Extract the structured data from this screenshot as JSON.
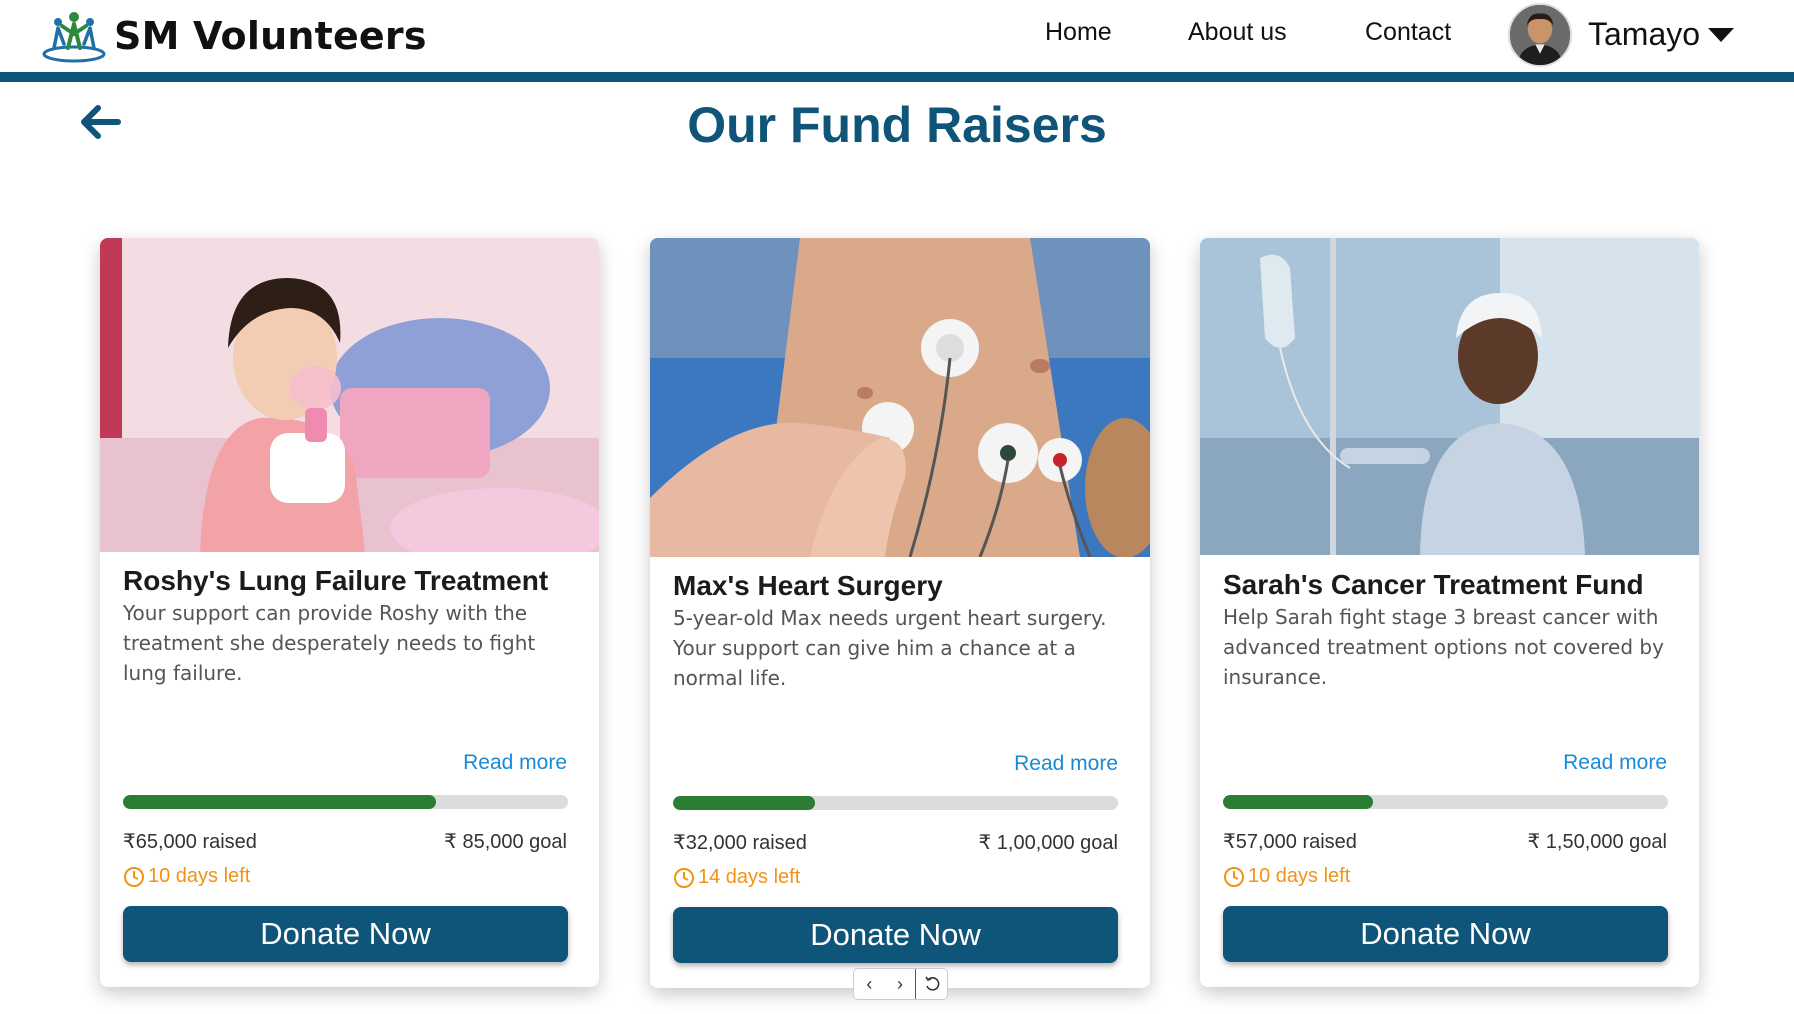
{
  "brand": {
    "name": "SM Volunteers",
    "icon": "people-logo-icon"
  },
  "nav": {
    "home": "Home",
    "about": "About us",
    "contact": "Contact"
  },
  "user": {
    "name": "Tamayo",
    "avatar": "user-avatar",
    "menu_icon": "caret-down-icon"
  },
  "page": {
    "title": "Our Fund Raisers",
    "back_icon": "arrow-left-icon"
  },
  "colors": {
    "primary": "#0f5479",
    "progress": "#2a7d32",
    "accent_orange": "#f39214",
    "link": "#1a8ad6"
  },
  "cards": [
    {
      "image": "child-with-oxygen-mask-photo",
      "title": "Roshy's Lung Failure Treatment",
      "description": "Your support can provide Roshy with the treatment she desperately needs to fight lung failure.",
      "read_more": "Read more",
      "progress_fraction": 0.703,
      "raised": "₹65,000 raised",
      "goal": "₹ 85,000 goal",
      "days_left": "10 days left",
      "donate": "Donate Now"
    },
    {
      "image": "chest-ecg-electrodes-photo",
      "title": "Max's Heart Surgery",
      "description": "5-year-old Max needs urgent heart surgery. Your support can give him a chance at a normal life.",
      "read_more": "Read more",
      "progress_fraction": 0.32,
      "raised": "₹32,000 raised",
      "goal": "₹ 1,00,000 goal",
      "days_left": "14 days left",
      "donate": "Donate Now"
    },
    {
      "image": "child-with-iv-drip-photo",
      "title": "Sarah's Cancer Treatment Fund",
      "description": "Help Sarah fight stage 3 breast cancer with advanced treatment options not covered by insurance.",
      "read_more": "Read more",
      "progress_fraction": 0.337,
      "raised": "₹57,000 raised",
      "goal": "₹ 1,50,000 goal",
      "days_left": "10 days left",
      "donate": "Donate Now"
    }
  ],
  "carousel_controls": {
    "prev_icon": "chevron-left-icon",
    "next_icon": "chevron-right-icon",
    "reset_icon": "rotate-ccw-icon"
  }
}
